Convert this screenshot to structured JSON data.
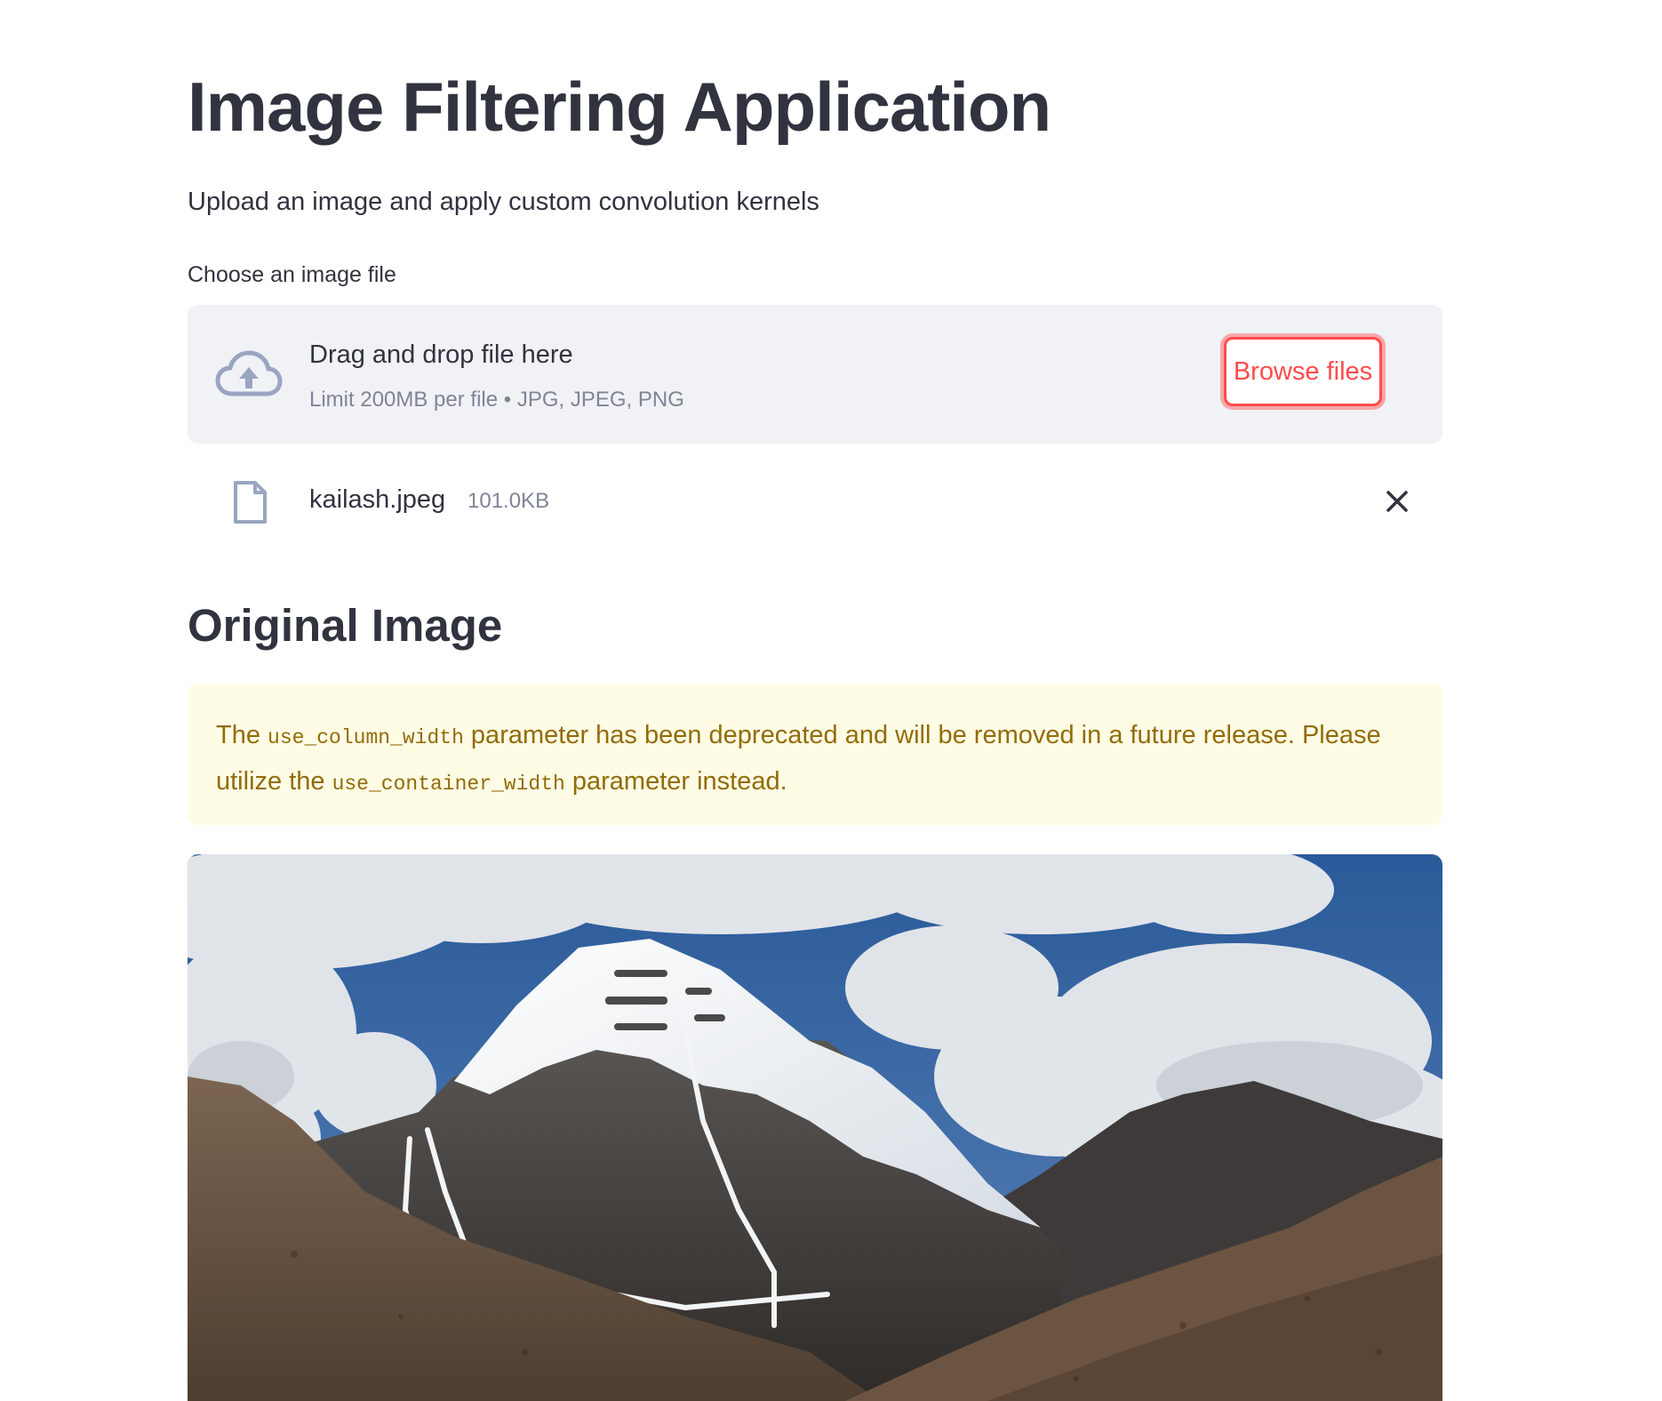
{
  "page": {
    "title": "Image Filtering Application",
    "subtitle": "Upload an image and apply custom convolution kernels"
  },
  "uploader": {
    "label": "Choose an image file",
    "drop_text": "Drag and drop file here",
    "limit_text": "Limit 200MB per file • JPG, JPEG, PNG",
    "browse_label": "Browse files",
    "icon": "cloud-upload-icon"
  },
  "uploaded_file": {
    "name": "kailash.jpeg",
    "size": "101.0KB",
    "icon": "file-icon",
    "remove_icon": "close-icon"
  },
  "section": {
    "heading": "Original Image"
  },
  "warning": {
    "text_1": "The ",
    "code_1": "use_column_width",
    "text_2": " parameter has been deprecated and will be removed in a future release. Please utilize the ",
    "code_2": "use_container_width",
    "text_3": " parameter instead."
  },
  "image": {
    "description": "Snow-capped mountain under blue sky with clouds",
    "colors": {
      "sky": "#2d5d9c",
      "cloud": "#e9ecef",
      "snow": "#f4f6f8",
      "rock": "#4a4644",
      "hill": "#6e5a48"
    }
  },
  "theme": {
    "accent": "#ff4b4b",
    "text": "#31333f",
    "muted": "#808495",
    "warning_bg": "#fffce6",
    "warning_text": "#926c05",
    "dropzone_bg": "#f0f2f6"
  }
}
